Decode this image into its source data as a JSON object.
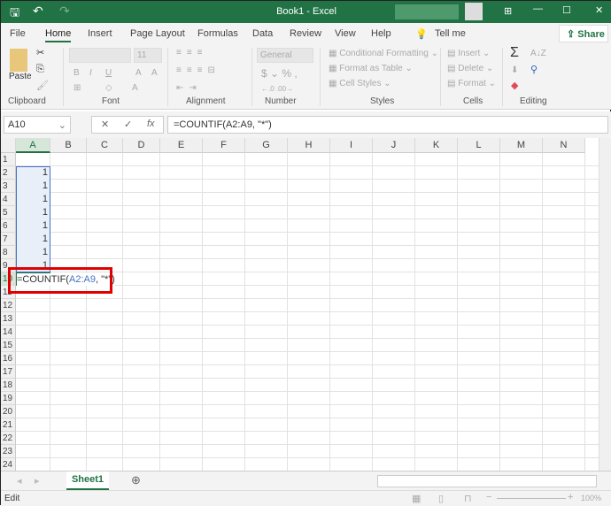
{
  "title": "Book1 - Excel",
  "tabs": [
    "File",
    "Home",
    "Insert",
    "Page Layout",
    "Formulas",
    "Data",
    "Review",
    "View",
    "Help",
    "Tell me"
  ],
  "share": "Share",
  "ribbon": {
    "paste": "Paste",
    "font_size": "11",
    "number_format": "General",
    "conditional": "Conditional Formatting",
    "format_table": "Format as Table",
    "cell_styles": "Cell Styles",
    "insert": "Insert",
    "delete": "Delete",
    "format": "Format",
    "groups": [
      "Clipboard",
      "Font",
      "Alignment",
      "Number",
      "Styles",
      "Cells",
      "Editing"
    ]
  },
  "name_box": "A10",
  "formula": "=COUNTIF(A2:A9, \"*\")",
  "columns": [
    "A",
    "B",
    "C",
    "D",
    "E",
    "F",
    "G",
    "H",
    "I",
    "J",
    "K",
    "L",
    "M",
    "N"
  ],
  "rows": [
    "1",
    "2",
    "3",
    "4",
    "5",
    "6",
    "7",
    "8",
    "9",
    "10",
    "11",
    "12",
    "13",
    "14",
    "15",
    "16",
    "17",
    "18",
    "19",
    "20",
    "21",
    "22",
    "23",
    "24"
  ],
  "cells_a": [
    "",
    "1",
    "1",
    "1",
    "1",
    "1",
    "1",
    "1",
    "1"
  ],
  "edit_cell": {
    "prefix": "=COUNTIF(",
    "range": "A2:A9",
    "suffix": ", \"*\")"
  },
  "sheet": "Sheet1",
  "status": "Edit",
  "zoom": "100%",
  "colors": {
    "brand": "#217346",
    "range": "#4472c4",
    "highlight": "#e00000"
  }
}
